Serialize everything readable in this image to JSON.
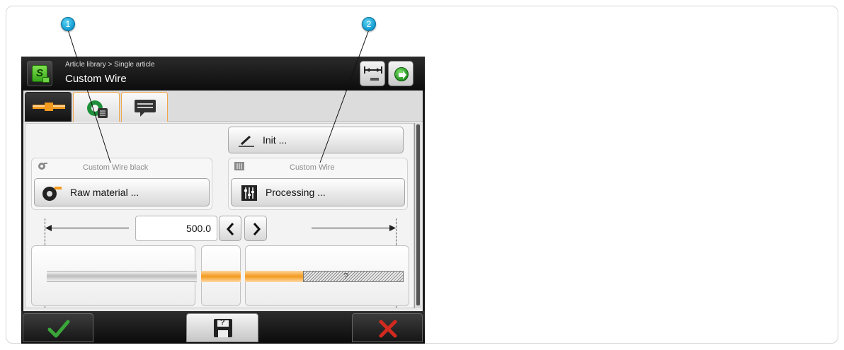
{
  "callouts": [
    "1",
    "2"
  ],
  "header": {
    "breadcrumb": "Article library > Single article",
    "title": "Custom Wire",
    "app_icon_letter": "S",
    "icons": [
      "length-measure-icon",
      "forward-arrow-icon"
    ]
  },
  "tabs": [
    {
      "icon": "wire-icon",
      "active": true
    },
    {
      "icon": "processing-list-icon",
      "active": false
    },
    {
      "icon": "comment-icon",
      "active": false
    }
  ],
  "init_button": {
    "label": "Init ...",
    "icon": "pencil-icon"
  },
  "raw_material": {
    "caption": "Custom Wire black",
    "button_label": "Raw material ...",
    "icon": "wire-reel-icon"
  },
  "processing": {
    "caption": "Custom Wire",
    "button_label": "Processing ...",
    "icon": "sliders-icon"
  },
  "length": {
    "value": "500.0",
    "decrease_icon": "chevron-left-icon",
    "increase_icon": "chevron-right-icon"
  },
  "wire_preview": {
    "unknown_marker": "?"
  },
  "bottom_bar": {
    "confirm_icon": "checkmark-icon",
    "save_icon": "save-unknown-icon",
    "cancel_icon": "close-icon",
    "save_marker": "?"
  },
  "colors": {
    "accent_orange": "#f29a1d",
    "confirm_green": "#3aa63a",
    "cancel_red": "#d12a1f",
    "callout_blue": "#129ad0"
  }
}
